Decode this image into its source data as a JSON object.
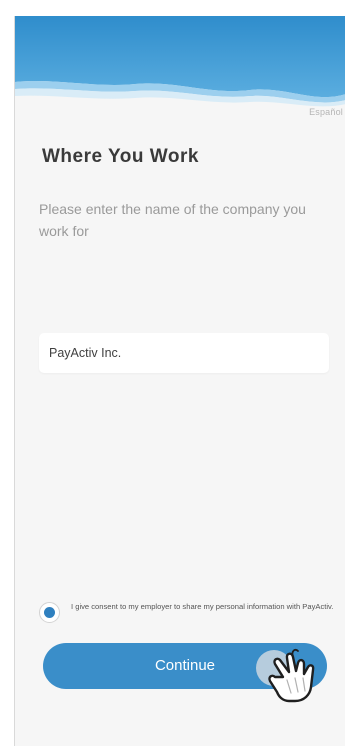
{
  "header": {
    "language_link": "Español",
    "wave_colors": [
      "#2f8dcc",
      "#6ab6e4",
      "#cfe7f5"
    ]
  },
  "main": {
    "title": "Where You Work",
    "subtitle": "Please enter the name of the company you work for",
    "company_input": {
      "value": "PayActiv Inc.",
      "placeholder": ""
    }
  },
  "consent": {
    "selected": true,
    "text": "I give consent to my employer to share my personal information with PayActiv."
  },
  "actions": {
    "continue_label": "Continue"
  },
  "overlay": {
    "cursor_icon": "hand-pointer-icon"
  },
  "colors": {
    "accent": "#3a8ec9",
    "radio_dot": "#2f80bf",
    "background": "#f6f6f6",
    "title": "#3a3a3a",
    "subtitle": "#9a9a9a"
  }
}
